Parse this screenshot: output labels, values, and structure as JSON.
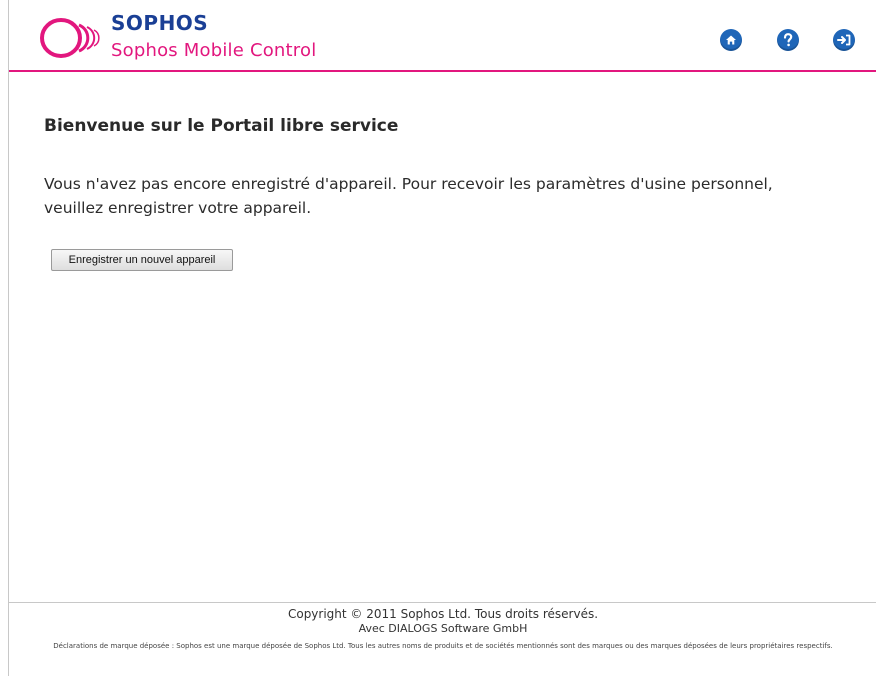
{
  "header": {
    "brand": "SOPHOS",
    "product": "Sophos Mobile Control",
    "icons": [
      "home-icon",
      "help-icon",
      "logout-icon"
    ]
  },
  "main": {
    "title": "Bienvenue sur le Portail libre service",
    "message": "Vous n'avez pas encore enregistré d'appareil. Pour recevoir les paramètres d'usine personnel, veuillez enregistrer votre appareil.",
    "register_button": "Enregistrer un nouvel appareil"
  },
  "footer": {
    "copyright": "Copyright © 2011 Sophos Ltd. Tous droits réservés.",
    "partner": "Avec DIALOGS Software GmbH",
    "legal": "Déclarations de marque déposée : Sophos est une marque déposée de Sophos Ltd. Tous les autres noms de produits et de sociétés mentionnés sont des marques ou des marques déposées de leurs propriétaires respectifs."
  },
  "colors": {
    "brand_blue": "#1a3f95",
    "accent_pink": "#e2177e",
    "icon_blue": "#1f66b8"
  }
}
